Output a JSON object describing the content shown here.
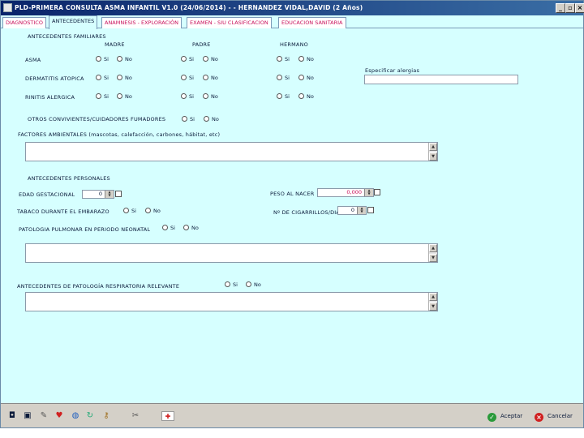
{
  "window": {
    "title": "PLD-PRIMERA CONSULTA ASMA INFANTIL V1.0 (24/06/2014) - - HERNANDEZ VIDAL,DAVID (2 Años)"
  },
  "tabs": [
    {
      "label": "DIAGNOSTICO"
    },
    {
      "label": "ANTECEDENTES"
    },
    {
      "label": "ANAMNESIS - EXPLORACIÓN"
    },
    {
      "label": "EXAMEN - SIU CLASIFICACION"
    },
    {
      "label": "EDUCACION SANITARIA"
    }
  ],
  "family": {
    "heading": "ANTECEDENTES FAMILIARES",
    "col_madre": "MADRE",
    "col_padre": "PADRE",
    "col_hermano": "HERMANO",
    "rows": [
      {
        "label": "ASMA"
      },
      {
        "label": "DERMATITIS ATOPICA"
      },
      {
        "label": "RINITIS ALERGICA"
      }
    ],
    "si": "Si",
    "no": "No",
    "specify_label": "Especificar alergias"
  },
  "smokers": {
    "label": "OTROS CONVIVIENTES/CUIDADORES FUMADORES",
    "si": "Si",
    "no": "No"
  },
  "triggers": {
    "label": "FACTORES AMBIENTALES (mascotas, calefacción, carbones, hábitat, etc)"
  },
  "personal": {
    "heading": "ANTECEDENTES PERSONALES",
    "gestational_label": "EDAD GESTACIONAL",
    "gestational_value": "0",
    "birth_weight_label": "PESO AL NACER",
    "birth_weight_value": "0,000",
    "pregnancy_tobacco_label": "TABACO DURANTE EL EMBARAZO",
    "cigarettes_label": "Nº DE CIGARRILLOS/DIA",
    "cigarettes_value": "0",
    "neonatal_label": "PATOLOGIA PULMONAR EN PERIODO NEONATAL",
    "respiratory_label": "ANTECEDENTES DE PATOLOGÍA RESPIRATORIA RELEVANTE",
    "si": "Si",
    "no": "No"
  },
  "footer": {
    "accept": "Aceptar",
    "cancel": "Cancelar"
  },
  "colors": {
    "title_bg": "#0a246a",
    "panel_bg": "#d6ffff",
    "tab_text": "#c8105a"
  }
}
